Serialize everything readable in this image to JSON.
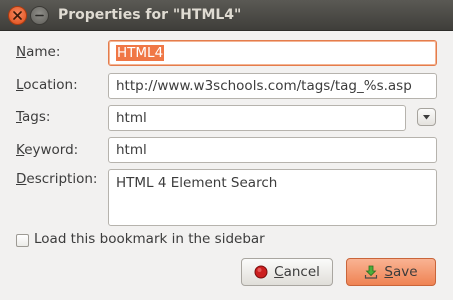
{
  "window": {
    "title": "Properties for \"HTML4\""
  },
  "form": {
    "name": {
      "label_prefix": "",
      "label_key": "N",
      "label_rest": "ame:",
      "value": "HTML4"
    },
    "location": {
      "label_prefix": "",
      "label_key": "L",
      "label_rest": "ocation:",
      "value": "http://www.w3schools.com/tags/tag_%s.asp"
    },
    "tags": {
      "label_prefix": "",
      "label_key": "T",
      "label_rest": "ags:",
      "value": "html"
    },
    "keyword": {
      "label_prefix": "",
      "label_key": "K",
      "label_rest": "eyword:",
      "value": "html"
    },
    "description": {
      "label_prefix": "",
      "label_key": "D",
      "label_rest": "escription:",
      "value": "HTML 4 Element Search"
    }
  },
  "sidebar_option": {
    "label_prefix": "Load t",
    "label_key": "h",
    "label_rest": "is bookmark in the sidebar",
    "checked": false
  },
  "buttons": {
    "cancel": {
      "label_key": "C",
      "label_rest": "ancel"
    },
    "save": {
      "label_key": "S",
      "label_rest": "ave"
    }
  },
  "colors": {
    "accent": "#f07746",
    "title_bar": "#4a4945",
    "save_button": "#ef8353",
    "close_button": "#e04b16"
  },
  "icons": {
    "close": "close-icon",
    "minimize": "minimize-icon",
    "cancel": "cancel-icon",
    "save": "save-icon",
    "dropdown": "chevron-down-icon"
  }
}
